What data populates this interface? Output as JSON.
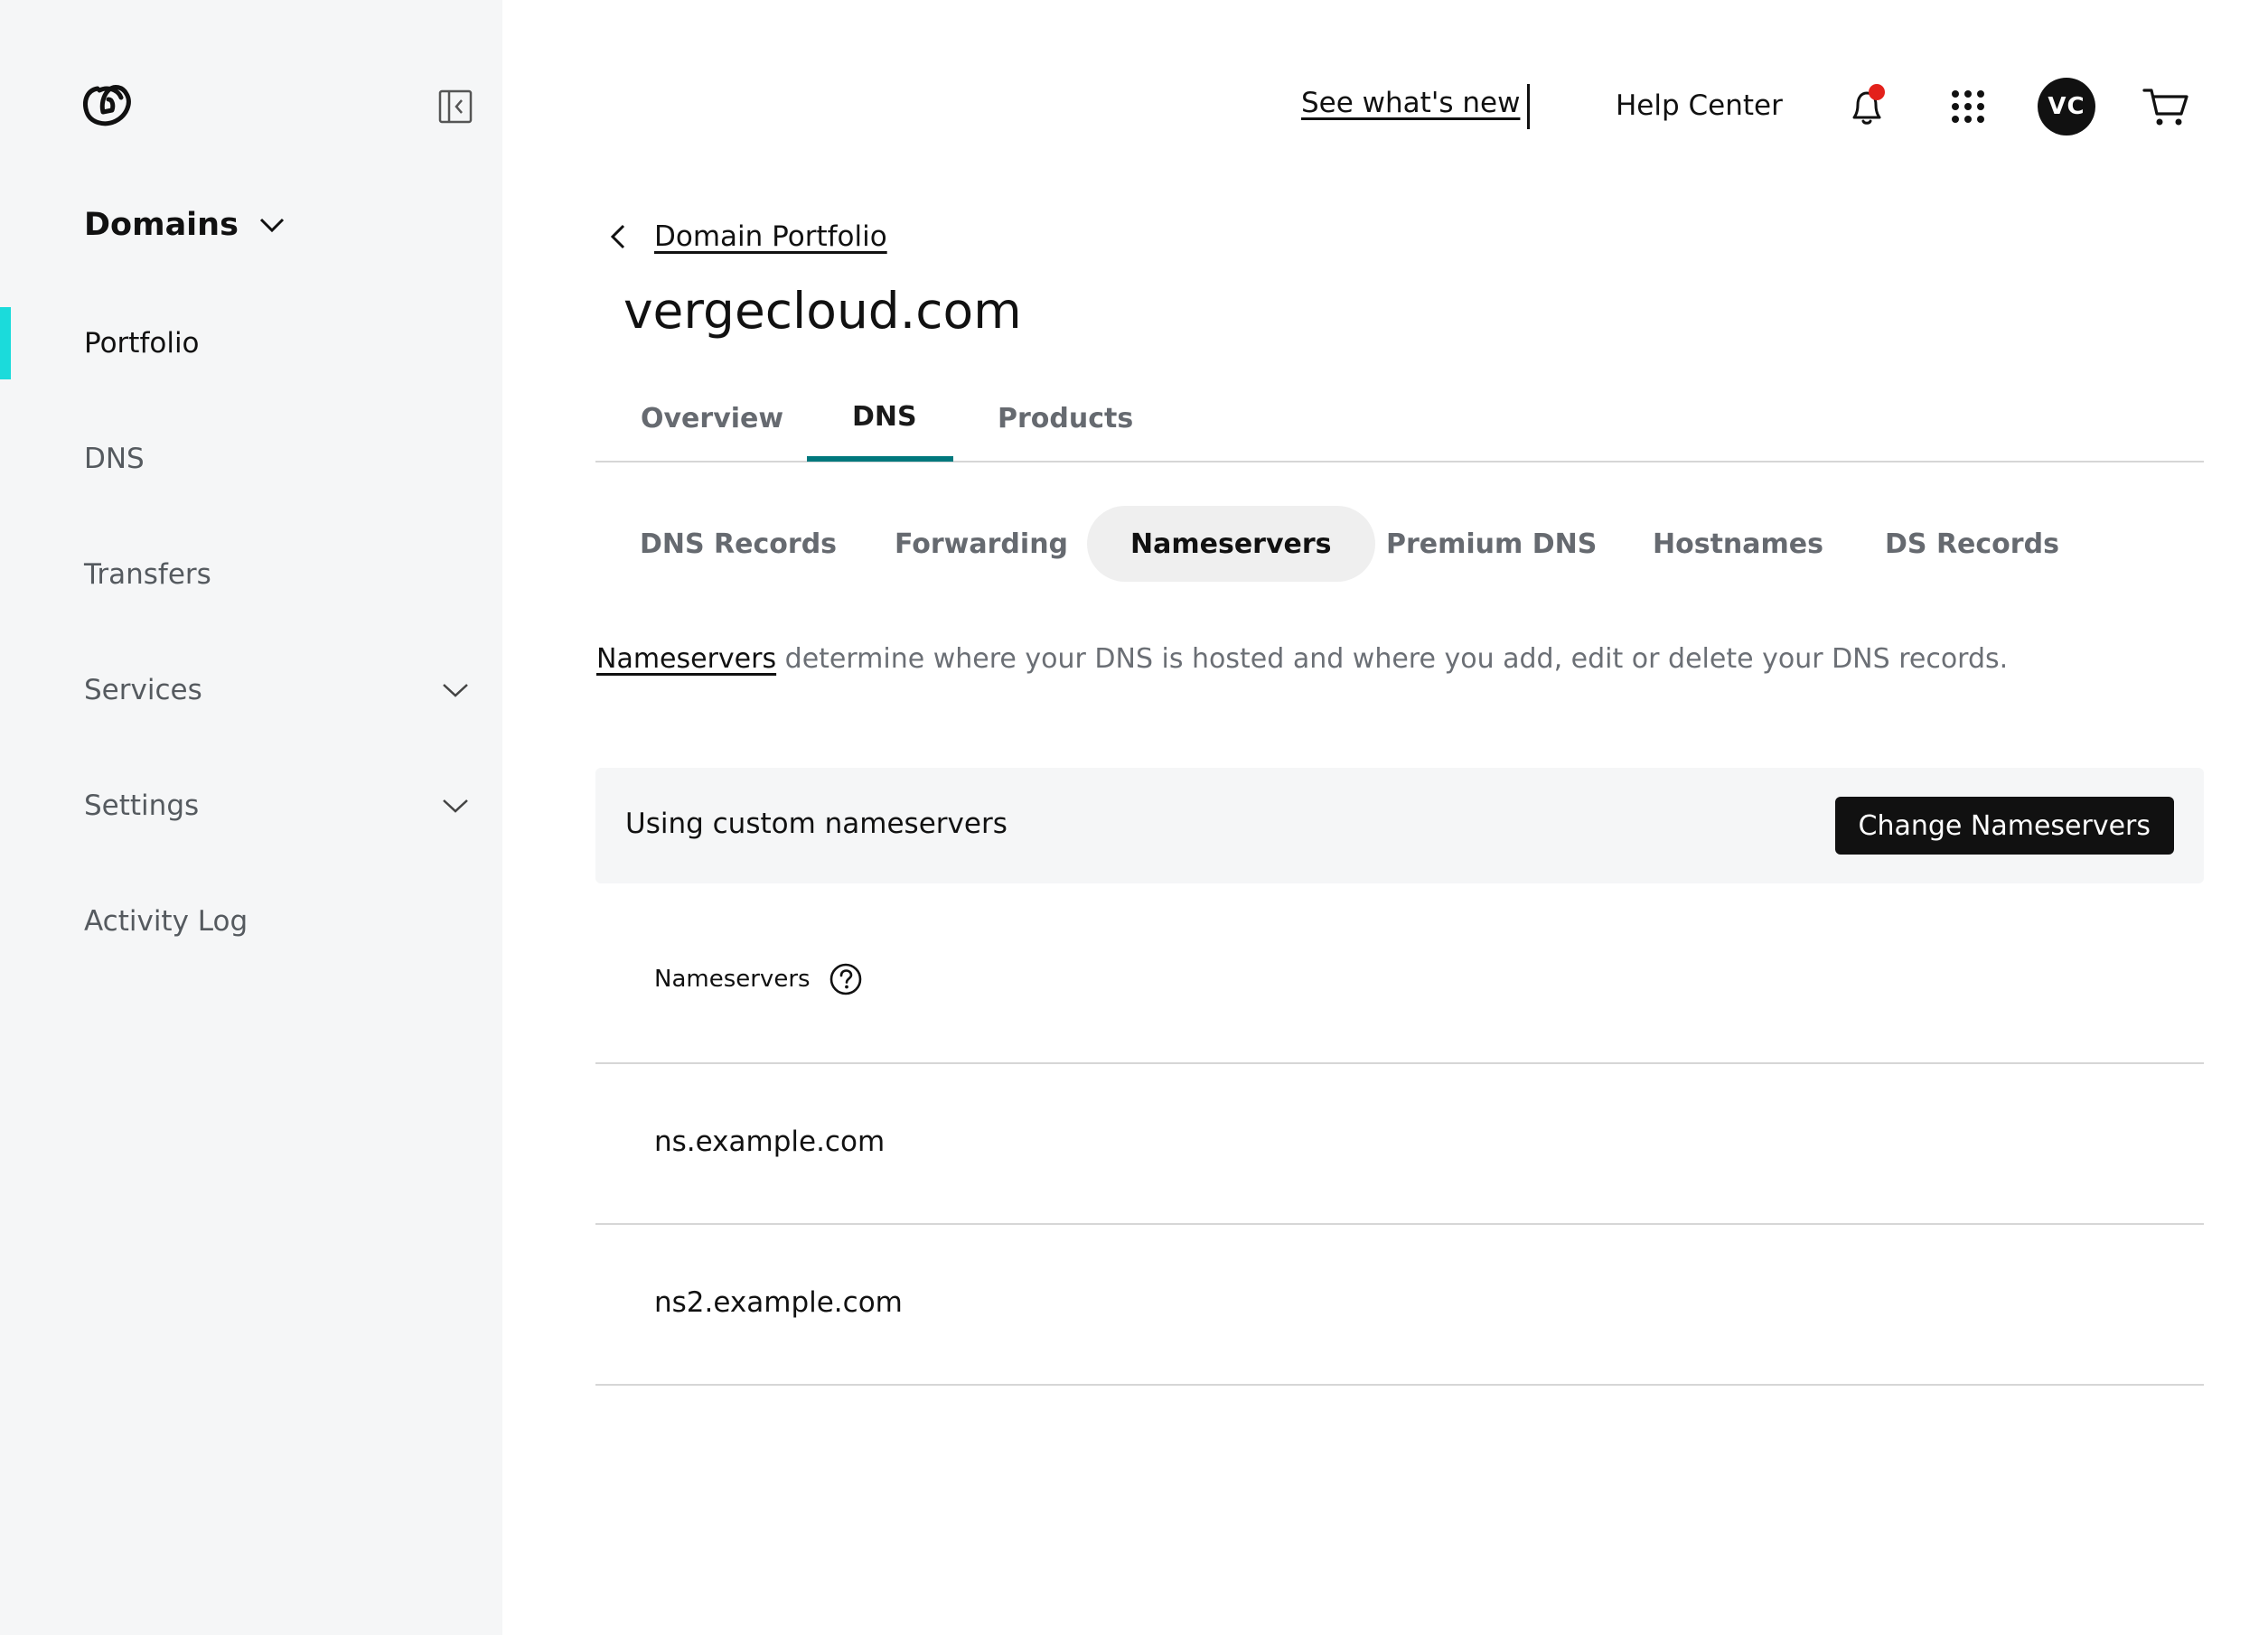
{
  "sidebar": {
    "section_title": "Domains",
    "items": [
      {
        "label": "Portfolio",
        "active": true
      },
      {
        "label": "DNS"
      },
      {
        "label": "Transfers"
      },
      {
        "label": "Services",
        "expandable": true
      },
      {
        "label": "Settings",
        "expandable": true
      },
      {
        "label": "Activity Log"
      }
    ],
    "accent_color": "#1bdbdb"
  },
  "topbar": {
    "whats_new": "See what's new",
    "help_center": "Help Center",
    "avatar_initials": "VC",
    "notification_dot_color": "#e3211b"
  },
  "breadcrumb": {
    "label": "Domain Portfolio"
  },
  "page": {
    "title": "vergecloud.com"
  },
  "main_tabs": [
    {
      "label": "Overview"
    },
    {
      "label": "DNS",
      "active": true
    },
    {
      "label": "Products"
    }
  ],
  "main_tab_accent": "#00787d",
  "sub_tabs": [
    {
      "label": "DNS Records"
    },
    {
      "label": "Forwarding"
    },
    {
      "label": "Nameservers",
      "active": true
    },
    {
      "label": "Premium DNS"
    },
    {
      "label": "Hostnames"
    },
    {
      "label": "DS Records"
    }
  ],
  "description": {
    "link": "Nameservers",
    "text": " determine where your DNS is hosted and where you add, edit or delete your DNS records."
  },
  "banner": {
    "text": "Using custom nameservers",
    "button": "Change Nameservers"
  },
  "nameservers": {
    "header": "Nameservers",
    "rows": [
      "ns.example.com",
      "ns2.example.com"
    ]
  }
}
